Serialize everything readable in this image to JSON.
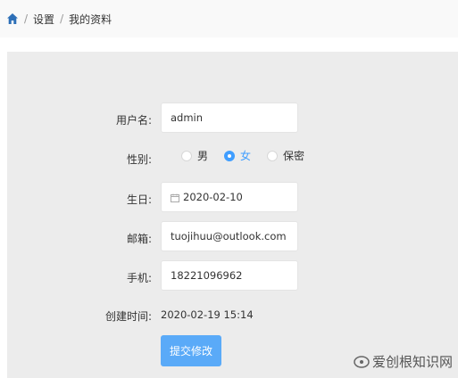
{
  "breadcrumb": {
    "home_icon": "home-icon",
    "sep": "/",
    "items": [
      "设置",
      "我的资料"
    ]
  },
  "form": {
    "username": {
      "label": "用户名:",
      "value": "admin"
    },
    "gender": {
      "label": "性别:",
      "options": [
        "男",
        "女",
        "保密"
      ],
      "selected": "女"
    },
    "birthday": {
      "label": "生日:",
      "value": "2020-02-10",
      "icon": "calendar-icon"
    },
    "email": {
      "label": "邮箱:",
      "value": "tuojihuu@outlook.com"
    },
    "phone": {
      "label": "手机:",
      "value": "18221096962"
    },
    "created": {
      "label": "创建时间:",
      "value": "2020-02-19 15:14"
    },
    "submit_label": "提交修改"
  },
  "watermark": {
    "text": "爱创根知识网"
  },
  "colors": {
    "accent": "#409eff",
    "button": "#5aaaf8",
    "panel": "#ececec"
  }
}
